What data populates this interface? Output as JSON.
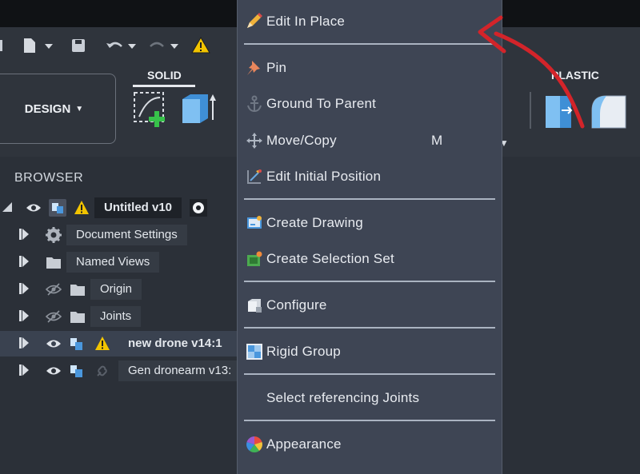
{
  "ribbon": {
    "design_label": "DESIGN",
    "tab_solid": "SOLID",
    "tab_plastic": "PLASTIC"
  },
  "browser": {
    "title": "BROWSER",
    "root": "Untitled v10",
    "items": [
      {
        "label": "Document Settings"
      },
      {
        "label": "Named Views"
      },
      {
        "label": "Origin"
      },
      {
        "label": "Joints"
      },
      {
        "label": "new drone v14:1"
      },
      {
        "label": "Gen dronearm v13:"
      }
    ]
  },
  "menu": {
    "items": [
      {
        "label": "Edit In Place"
      },
      {
        "label": "Pin"
      },
      {
        "label": "Ground To Parent"
      },
      {
        "label": "Move/Copy",
        "shortcut": "M"
      },
      {
        "label": "Edit Initial Position"
      },
      {
        "label": "Create Drawing"
      },
      {
        "label": "Create Selection Set"
      },
      {
        "label": "Configure"
      },
      {
        "label": "Rigid Group"
      },
      {
        "label": "Select referencing Joints"
      },
      {
        "label": "Appearance"
      }
    ]
  },
  "colors": {
    "annotation_arrow": "#d3242a",
    "warning": "#f2c400",
    "selection_bg": "#3a4250",
    "menu_bg": "#3e4554"
  },
  "icons": [
    "new-file-icon",
    "save-icon",
    "undo-icon",
    "redo-icon",
    "warning-icon",
    "eye-icon",
    "gear-icon",
    "folder-icon",
    "component-icon",
    "pencil-icon",
    "pin-icon",
    "anchor-icon",
    "move-icon",
    "drawing-icon",
    "selection-set-icon",
    "configure-icon",
    "rigid-group-icon",
    "appearance-icon"
  ]
}
